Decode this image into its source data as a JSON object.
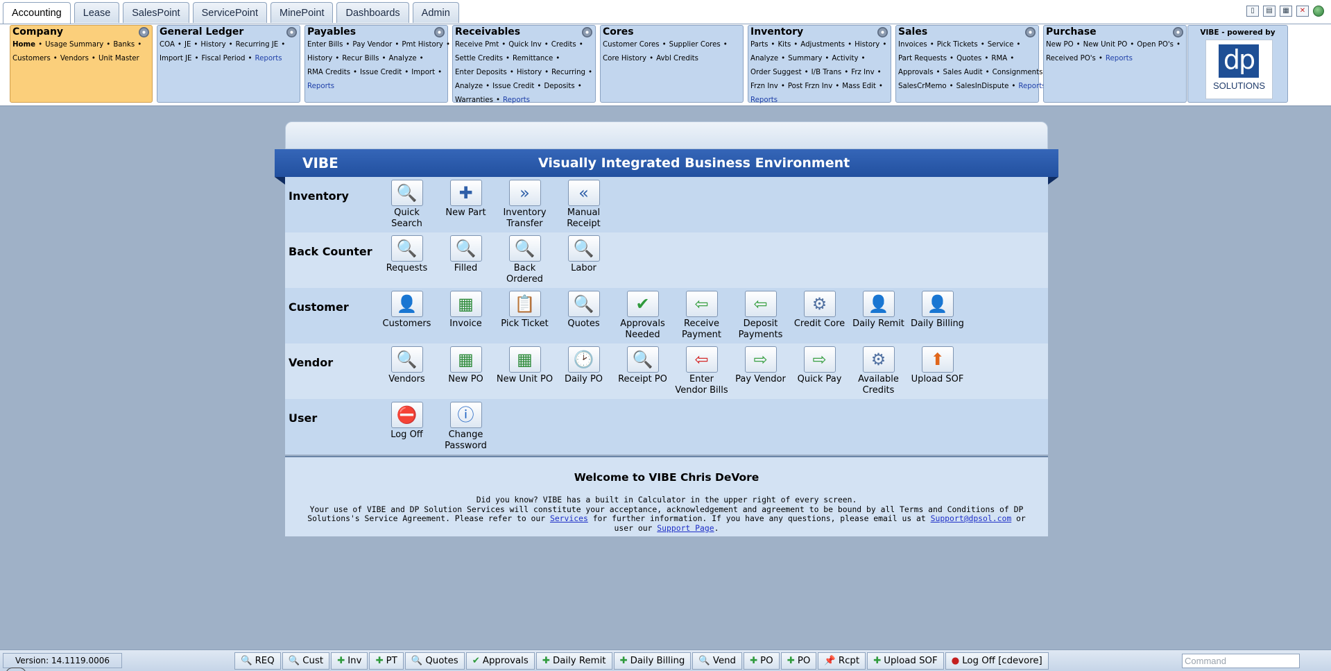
{
  "tabs": [
    "Accounting",
    "Lease",
    "SalesPoint",
    "ServicePoint",
    "MinePoint",
    "Dashboards",
    "Admin"
  ],
  "panels": {
    "company": {
      "title": "Company",
      "links": [
        "Home",
        "Usage Summary",
        "Banks",
        "Customers",
        "Vendors",
        "Unit Master"
      ]
    },
    "gl": {
      "title": "General Ledger",
      "links": [
        "COA",
        "JE",
        "History",
        "Recurring JE",
        "Import JE",
        "Fiscal Period",
        "Reports"
      ]
    },
    "payables": {
      "title": "Payables",
      "links": [
        "Enter Bills",
        "Pay Vendor",
        "Pmt History",
        "History",
        "Recur Bills",
        "Analyze",
        "RMA Credits",
        "Issue Credit",
        "Import",
        "Reports"
      ]
    },
    "receivables": {
      "title": "Receivables",
      "links": [
        "Receive Pmt",
        "Quick Inv",
        "Credits",
        "Settle Credits",
        "Remittance",
        "Enter Deposits",
        "History",
        "Recurring",
        "Analyze",
        "Issue Credit",
        "Deposits",
        "Warranties",
        "Reports"
      ]
    },
    "cores": {
      "title": "Cores",
      "links": [
        "Customer Cores",
        "Supplier Cores",
        "Core History",
        "Avbl Credits"
      ]
    },
    "inventory": {
      "title": "Inventory",
      "links": [
        "Parts",
        "Kits",
        "Adjustments",
        "History",
        "Analyze",
        "Summary",
        "Activity",
        "Order Suggest",
        "I/B Trans",
        "Frz Inv",
        "Frzn Inv",
        "Post Frzn Inv",
        "Mass Edit",
        "Reports"
      ]
    },
    "sales": {
      "title": "Sales",
      "links": [
        "Invoices",
        "Pick Tickets",
        "Service",
        "Part Requests",
        "Quotes",
        "RMA",
        "Approvals",
        "Sales Audit",
        "Consignments",
        "SalesCrMemo",
        "SalesInDispute",
        "Reports"
      ]
    },
    "purchase": {
      "title": "Purchase",
      "links": [
        "New PO",
        "New Unit PO",
        "Open PO's",
        "Received PO's",
        "Reports"
      ]
    }
  },
  "logo": {
    "caption": "VIBE - powered by",
    "mark": "dp",
    "sub": "SOLUTIONS"
  },
  "banner": {
    "short": "VIBE",
    "title": "Visually Integrated Business Environment"
  },
  "rows": {
    "inventory": {
      "label": "Inventory",
      "items": [
        {
          "l1": "Quick",
          "l2": "Search"
        },
        {
          "l1": "New Part",
          "l2": ""
        },
        {
          "l1": "Inventory",
          "l2": "Transfer"
        },
        {
          "l1": "Manual",
          "l2": "Receipt"
        }
      ]
    },
    "backcounter": {
      "label": "Back Counter",
      "items": [
        {
          "l1": "Requests",
          "l2": ""
        },
        {
          "l1": "Filled",
          "l2": ""
        },
        {
          "l1": "Back",
          "l2": "Ordered"
        },
        {
          "l1": "Labor",
          "l2": ""
        }
      ]
    },
    "customer": {
      "label": "Customer",
      "items": [
        {
          "l1": "Customers",
          "l2": ""
        },
        {
          "l1": "Invoice",
          "l2": ""
        },
        {
          "l1": "Pick Ticket",
          "l2": ""
        },
        {
          "l1": "Quotes",
          "l2": ""
        },
        {
          "l1": "Approvals",
          "l2": "Needed"
        },
        {
          "l1": "Receive",
          "l2": "Payment"
        },
        {
          "l1": "Deposit",
          "l2": "Payments"
        },
        {
          "l1": "Credit Core",
          "l2": ""
        },
        {
          "l1": "Daily Remit",
          "l2": ""
        },
        {
          "l1": "Daily Billing",
          "l2": ""
        }
      ]
    },
    "vendor": {
      "label": "Vendor",
      "items": [
        {
          "l1": "Vendors",
          "l2": ""
        },
        {
          "l1": "New PO",
          "l2": ""
        },
        {
          "l1": "New Unit PO",
          "l2": ""
        },
        {
          "l1": "Daily PO",
          "l2": ""
        },
        {
          "l1": "Receipt PO",
          "l2": ""
        },
        {
          "l1": "Enter",
          "l2": "Vendor Bills"
        },
        {
          "l1": "Pay Vendor",
          "l2": ""
        },
        {
          "l1": "Quick Pay",
          "l2": ""
        },
        {
          "l1": "Available",
          "l2": "Credits"
        },
        {
          "l1": "Upload SOF",
          "l2": ""
        }
      ]
    },
    "user": {
      "label": "User",
      "items": [
        {
          "l1": "Log Off",
          "l2": ""
        },
        {
          "l1": "Change",
          "l2": "Password"
        }
      ]
    }
  },
  "welcome": {
    "title": "Welcome to VIBE Chris DeVore",
    "line1": "Did you know? VIBE has a built in Calculator in the upper right of every screen.",
    "line2a": "Your use of VIBE and DP Solution Services will constitute your acceptance, acknowledgement and agreement to be bound by all Terms and Conditions of DP Solutions's Service Agreement. Please refer to our ",
    "services_link": "Services",
    "line2b": " for further information. If you have any questions, please email us at ",
    "email_link": "Support@dpsol.com",
    "line2c": " or user our ",
    "support_link": "Support Page",
    "line2d": "."
  },
  "statusbar": {
    "version": "Version: 14.1119.0006",
    "buttons": [
      "REQ",
      "Cust",
      "Inv",
      "PT",
      "Quotes",
      "Approvals",
      "Daily Remit",
      "Daily Billing",
      "Vend",
      "PO",
      "PO",
      "Rcpt",
      "Upload SOF",
      "Log Off [cdevore]"
    ],
    "command_placeholder": "Command"
  },
  "colors": {
    "background": "#9fb1c7",
    "panel": "#c2d6ee",
    "company_panel": "#fbcf7b",
    "banner": "#2b5bab",
    "link_reports": "#1e3fa8"
  }
}
